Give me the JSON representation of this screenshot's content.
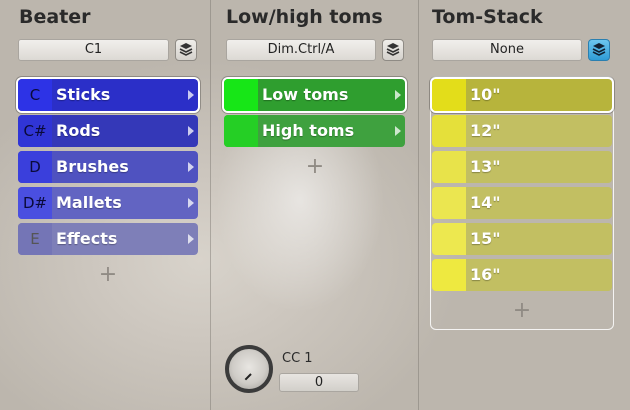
{
  "beater": {
    "title": "Beater",
    "selector_value": "C1",
    "items": [
      {
        "key": "C",
        "label": "Sticks",
        "color": "#2b2fc8",
        "key_color": "#2d33e6",
        "selected": true
      },
      {
        "key": "C#",
        "label": "Rods",
        "color": "#3438b8",
        "key_color": "#3035d6",
        "selected": false
      },
      {
        "key": "D",
        "label": "Brushes",
        "color": "#4f52c0",
        "key_color": "#3a3fdc",
        "selected": false
      },
      {
        "key": "D#",
        "label": "Mallets",
        "color": "#6264c2",
        "key_color": "#4a4fe0",
        "selected": false
      },
      {
        "key": "E",
        "label": "Effects",
        "color": "#7e7fb8",
        "key_color": "#7475b6",
        "selected": false
      }
    ]
  },
  "toms": {
    "title": "Low/high toms",
    "selector_value": "Dim.Ctrl/A",
    "items": [
      {
        "label": "Low toms",
        "color": "#2f9e2f",
        "key_color": "#17e617",
        "selected": true
      },
      {
        "label": "High toms",
        "color": "#3fa13f",
        "key_color": "#25cf25",
        "selected": false
      }
    ],
    "cc_label": "CC 1",
    "cc_value": "0",
    "knob_value": 0
  },
  "stack": {
    "title": "Tom-Stack",
    "selector_value": "None",
    "items": [
      {
        "label": "10\"",
        "color": "#b7b43c",
        "key_color": "#e3dd1a",
        "selected": true
      },
      {
        "label": "12\"",
        "color": "#c2bf62",
        "key_color": "#e5e03a",
        "selected": false
      },
      {
        "label": "13\"",
        "color": "#c2bf62",
        "key_color": "#e8e34a",
        "selected": false
      },
      {
        "label": "14\"",
        "color": "#c2bf62",
        "key_color": "#ebe650",
        "selected": false
      },
      {
        "label": "15\"",
        "color": "#c2bf62",
        "key_color": "#ede84f",
        "selected": false
      },
      {
        "label": "16\"",
        "color": "#c2bf62",
        "key_color": "#eee940",
        "selected": false
      }
    ]
  },
  "icons": {
    "layer": "layers-icon",
    "add": "plus-icon",
    "arrow": "chevron-right-icon"
  }
}
